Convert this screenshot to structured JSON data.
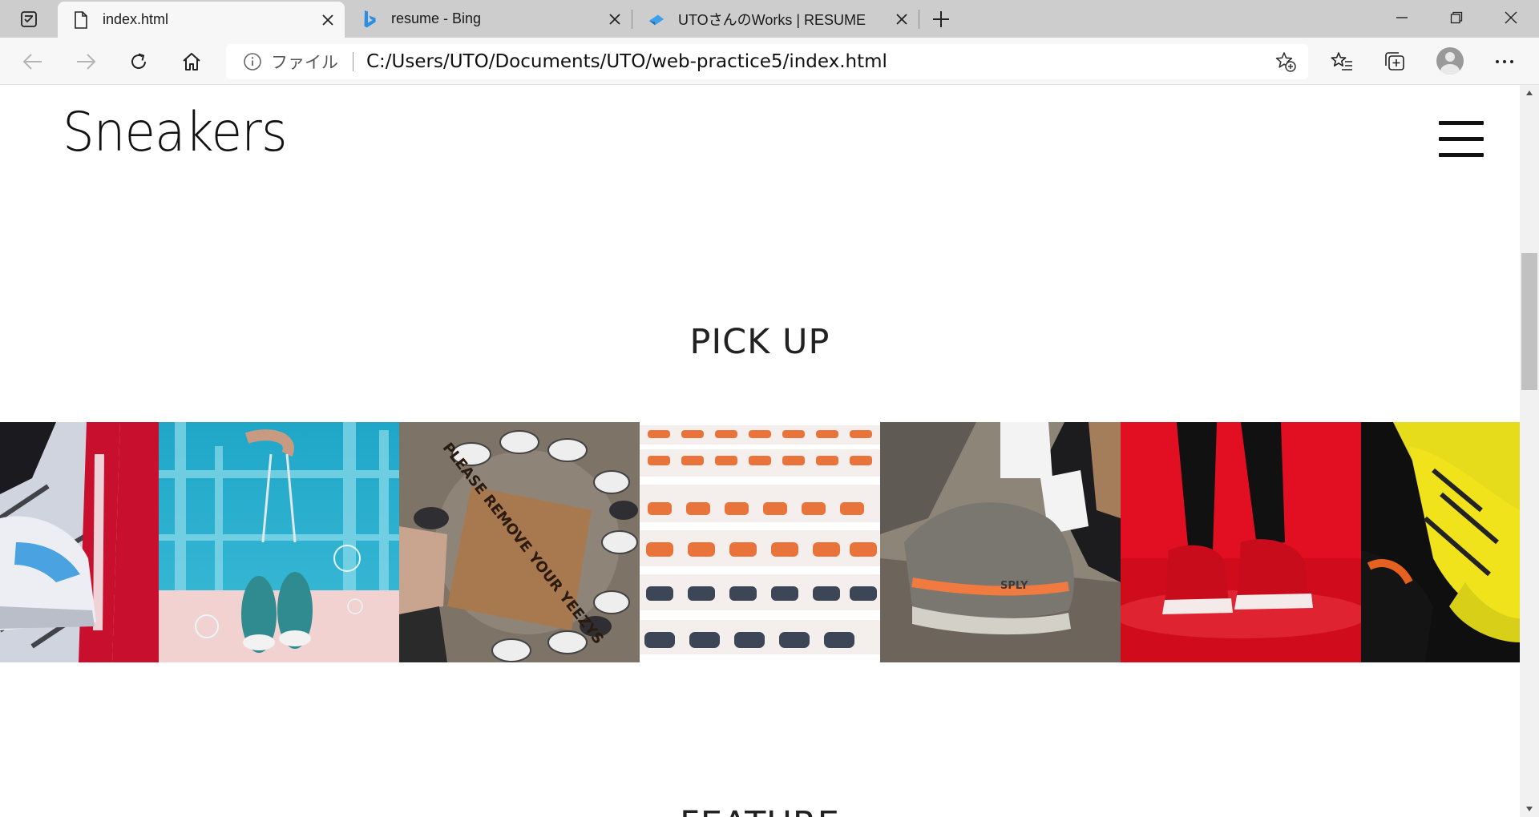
{
  "browser": {
    "tabs": [
      {
        "title": "index.html",
        "active": true,
        "icon": "page-icon"
      },
      {
        "title": "resume - Bing",
        "active": false,
        "icon": "bing-icon"
      },
      {
        "title": "UTOさんのWorks | RESUME",
        "active": false,
        "icon": "site-icon"
      }
    ],
    "address": {
      "scheme": "ファイル",
      "url": "C:/Users/UTO/Documents/UTO/web-practice5/index.html"
    }
  },
  "page": {
    "logo": "Sneakers",
    "pickup_heading": "PICK UP",
    "feature_heading": "FEATURE",
    "gallery": [
      {
        "name": "red-supreme-sneaker"
      },
      {
        "name": "teal-sneakers-hanging"
      },
      {
        "name": "please-remove-your-yeezys"
      },
      {
        "name": "sneaker-wall-display"
      },
      {
        "name": "yeezy-sply-350"
      },
      {
        "name": "red-jordan-red-floor"
      },
      {
        "name": "yellow-sneaker"
      }
    ],
    "photo_text": {
      "doormat": "PLEASE REMOVE YOUR YEEZYS",
      "sply": "SPLY"
    }
  },
  "colors": {
    "tabbar": "#cdcdcd",
    "toolbar": "#f7f7f7",
    "accent": "#0078d4"
  }
}
